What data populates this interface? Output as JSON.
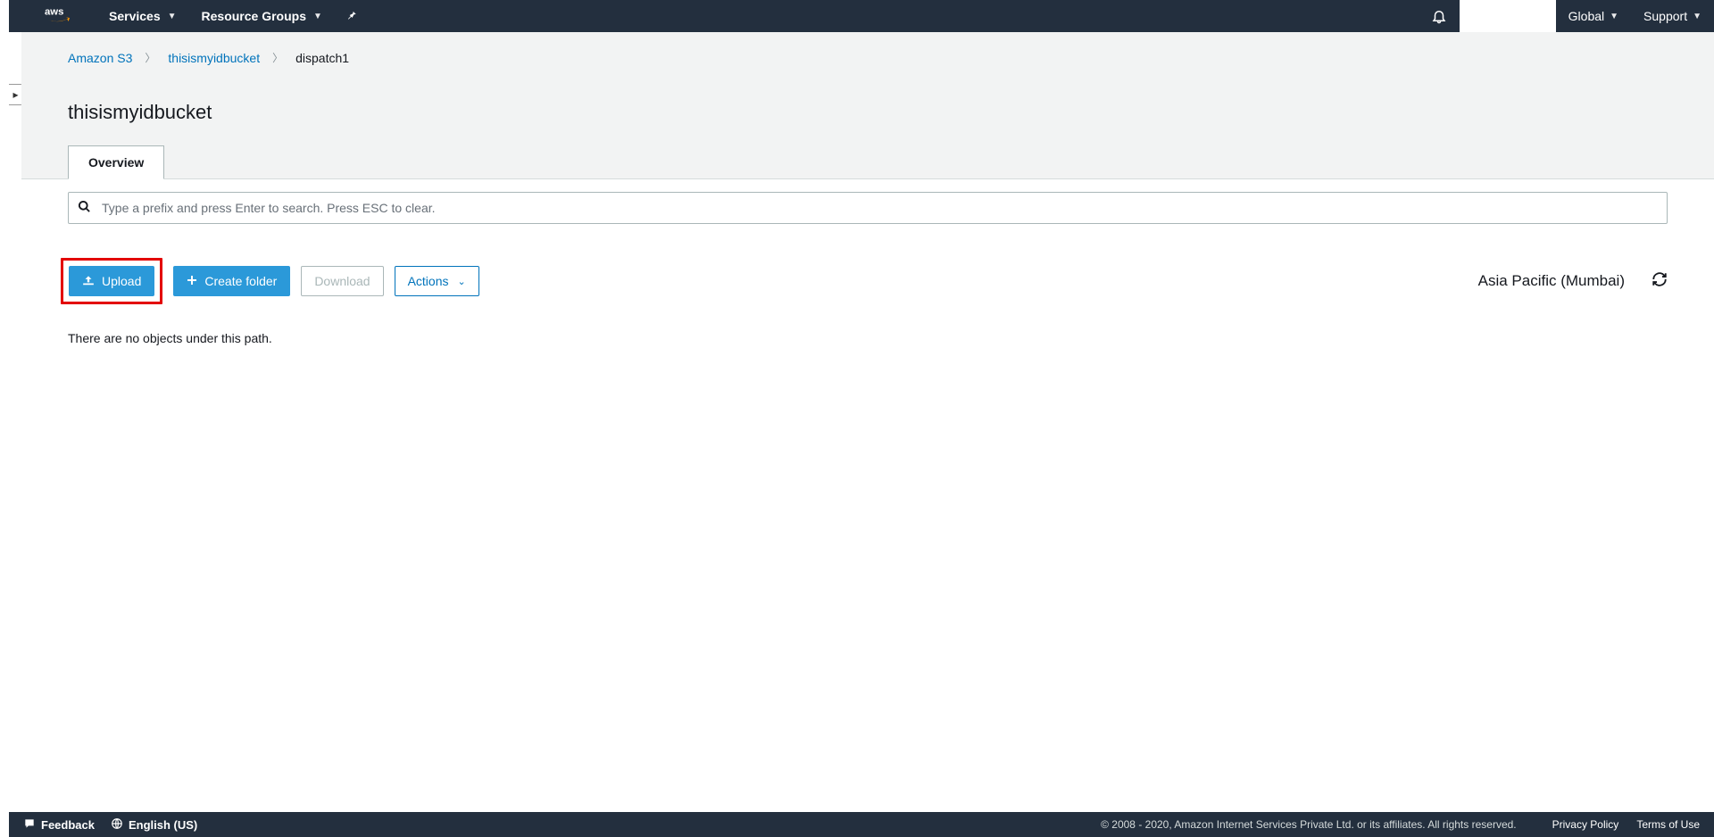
{
  "topnav": {
    "services": "Services",
    "resource_groups": "Resource Groups",
    "global": "Global",
    "support": "Support"
  },
  "breadcrumb": {
    "root": "Amazon S3",
    "bucket": "thisismyidbucket",
    "folder": "dispatch1"
  },
  "page_title": "thisismyidbucket",
  "tabs": {
    "overview": "Overview"
  },
  "search": {
    "placeholder": "Type a prefix and press Enter to search. Press ESC to clear."
  },
  "buttons": {
    "upload": "Upload",
    "create_folder": "Create folder",
    "download": "Download",
    "actions": "Actions"
  },
  "region": "Asia Pacific (Mumbai)",
  "empty_message": "There are no objects under this path.",
  "footer": {
    "feedback": "Feedback",
    "language": "English (US)",
    "copyright": "© 2008 - 2020, Amazon Internet Services Private Ltd. or its affiliates. All rights reserved.",
    "privacy": "Privacy Policy",
    "terms": "Terms of Use"
  }
}
